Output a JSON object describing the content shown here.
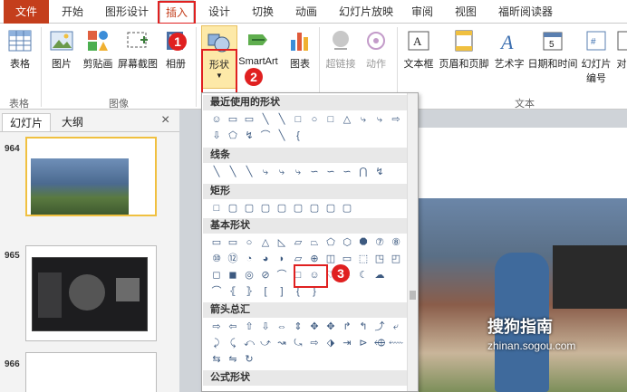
{
  "tabs": [
    "文件",
    "开始",
    "图形设计",
    "插入",
    "设计",
    "切换",
    "动画",
    "幻灯片放映",
    "审阅",
    "视图",
    "福昕阅读器"
  ],
  "ribbon": {
    "buttons": [
      "表格",
      "图片",
      "剪贴画",
      "屏幕截图",
      "相册",
      "形状",
      "SmartArt",
      "图表",
      "超链接",
      "动作",
      "文本框",
      "页眉和页脚",
      "艺术字",
      "日期和时间",
      "幻灯片编号",
      "对"
    ],
    "groups": [
      "表格",
      "图像",
      "文本"
    ]
  },
  "badges": [
    "1",
    "2",
    "3"
  ],
  "pane": {
    "tabs": [
      "幻灯片",
      "大纲"
    ],
    "close": "×",
    "slides": [
      "964",
      "965",
      "966"
    ]
  },
  "dropdown": {
    "sections": [
      "最近使用的形状",
      "线条",
      "矩形",
      "基本形状",
      "箭头总汇",
      "公式形状"
    ]
  },
  "watermark": {
    "brand": "搜狗指南",
    "url": "zhinan.sogou.com"
  },
  "colors": {
    "file_tab": "#c43e1c",
    "highlight": "#e02020",
    "shape_fill": "#3d5a80"
  }
}
